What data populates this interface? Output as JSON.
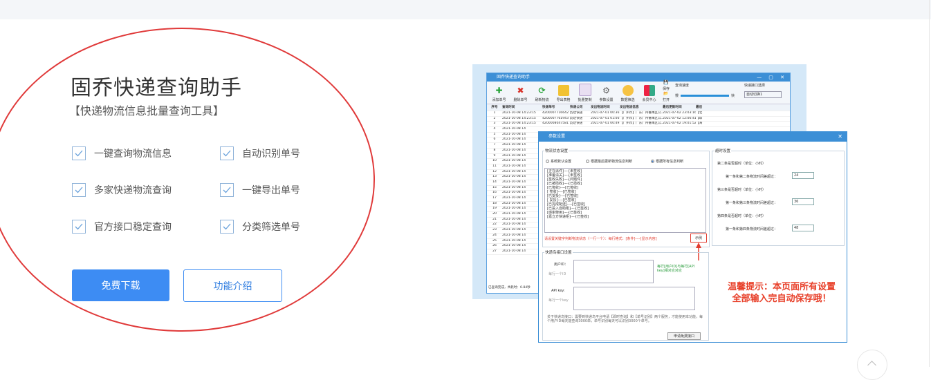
{
  "hero": {
    "title": "固乔快递查询助手",
    "subtitle": "【快递物流信息批量查询工具】",
    "features": [
      "一键查询物流信息",
      "自动识别单号",
      "多家快递物流查询",
      "一键导出单号",
      "官方接口稳定查询",
      "分类筛选单号"
    ],
    "download_label": "免费下载",
    "intro_label": "功能介绍",
    "annotation_color": "#e03a3a",
    "primary_color": "#3d8cf3"
  },
  "screenshot": {
    "main_window": {
      "title": "固乔快递查询助手",
      "toolbar": [
        {
          "label": "添加单号",
          "icon": "plus-icon"
        },
        {
          "label": "删除单号",
          "icon": "delete-x-icon"
        },
        {
          "label": "刷新物流",
          "icon": "refresh-icon"
        },
        {
          "label": "导出表格",
          "icon": "export-icon"
        },
        {
          "label": "批量复制",
          "icon": "copy-icon"
        },
        {
          "label": "参数设置",
          "icon": "gear-icon"
        },
        {
          "label": "数据筛选",
          "icon": "user-filter-icon"
        },
        {
          "label": "会员中心",
          "icon": "vip-icon"
        },
        {
          "label": "保存",
          "icon": "save-icon"
        },
        {
          "label": "打开",
          "icon": "open-icon"
        }
      ],
      "query_speed_label": "查询速度",
      "slow_label": "慢",
      "fast_label": "快",
      "interface_label": "快递接口选择",
      "interface_value": "自动切换1",
      "columns": [
        "序号",
        "查询时间",
        "快递单号",
        "快递公司",
        "发出物流时间",
        "发出物流信息",
        "最后更新时间",
        "最后"
      ],
      "rows": [
        [
          "1",
          "2021-10-08 14:23:15",
          "4200007716642",
          "韵达快递",
          "2021-07-01 00:36:45",
          "【广州市】广东广州番禺区公...",
          "2021-07-02 23:03:16",
          "【北"
        ],
        [
          "2",
          "2021-10-08 14:23:15",
          "4200007761943",
          "韵达快递",
          "2021-07-01 01:00:32",
          "【广州市】广东广州番禺区公...",
          "2021-07-02 12:06:41",
          "【珠"
        ],
        [
          "3",
          "2021-10-08 14:23:15",
          "4200008047581",
          "韵达快递",
          "2021-07-01 00:49:58",
          "【广州市】广东广州番禺区公...",
          "2021-07-02 19:01:52",
          "【海"
        ],
        [
          "4",
          "2021-10-08 14",
          "",
          "",
          "",
          "",
          "",
          ""
        ],
        [
          "5",
          "2021-10-08 14",
          "",
          "",
          "",
          "",
          "",
          ""
        ],
        [
          "6",
          "2021-10-08 14",
          "",
          "",
          "",
          "",
          "",
          ""
        ],
        [
          "7",
          "2021-10-08 14",
          "",
          "",
          "",
          "",
          "",
          ""
        ],
        [
          "8",
          "2021-10-08 14",
          "",
          "",
          "",
          "",
          "",
          ""
        ],
        [
          "9",
          "2021-10-08 14",
          "",
          "",
          "",
          "",
          "",
          ""
        ],
        [
          "10",
          "2021-10-08 14",
          "",
          "",
          "",
          "",
          "",
          ""
        ],
        [
          "11",
          "2021-10-08 14",
          "",
          "",
          "",
          "",
          "",
          ""
        ],
        [
          "12",
          "2021-10-08 14",
          "",
          "",
          "",
          "",
          "",
          ""
        ],
        [
          "13",
          "2021-10-08 14",
          "",
          "",
          "",
          "",
          "",
          ""
        ],
        [
          "14",
          "2021-10-08 14",
          "",
          "",
          "",
          "",
          "",
          ""
        ],
        [
          "15",
          "2021-10-08 14",
          "",
          "",
          "",
          "",
          "",
          ""
        ],
        [
          "16",
          "2021-10-08 14",
          "",
          "",
          "",
          "",
          "",
          ""
        ],
        [
          "17",
          "2021-10-08 14",
          "",
          "",
          "",
          "",
          "",
          ""
        ],
        [
          "18",
          "2021-10-08 14",
          "",
          "",
          "",
          "",
          "",
          ""
        ],
        [
          "19",
          "2021-10-08 14",
          "",
          "",
          "",
          "",
          "",
          ""
        ],
        [
          "20",
          "2021-10-08 14",
          "",
          "",
          "",
          "",
          "",
          ""
        ],
        [
          "21",
          "2021-10-08 14",
          "",
          "",
          "",
          "",
          "",
          ""
        ],
        [
          "22",
          "2021-10-08 14",
          "",
          "",
          "",
          "",
          "",
          ""
        ],
        [
          "23",
          "2021-10-08 14",
          "",
          "",
          "",
          "",
          "",
          ""
        ],
        [
          "24",
          "2021-10-08 14",
          "",
          "",
          "",
          "",
          "",
          ""
        ],
        [
          "25",
          "2021-10-08 14",
          "",
          "",
          "",
          "",
          "",
          ""
        ],
        [
          "26",
          "2021-10-08 14",
          "",
          "",
          "",
          "",
          "",
          ""
        ],
        [
          "27",
          "2021-10-08 14",
          "",
          "",
          "",
          "",
          "",
          ""
        ]
      ],
      "status": "已查询完成，共耗时：0.84秒"
    },
    "settings_dialog": {
      "title": "参数设置",
      "status_group_label": "物流状态设置",
      "radio_options": [
        "系统默认设置",
        "根据最后更新物流信息判断",
        "根据所有信息判断"
      ],
      "status_lines": [
        "[正在派件]----[未签收]",
        "[准备清关]----[未签收]",
        "[签收失败]----[问题件]",
        "[已被揽收]----[已揽收]",
        "[已签收]----[已签收]",
        "[ 签收]----[已签收]",
        "[已妥投]----[已签收]",
        "[ 妥投]----[已签收]",
        "[已完成配送]----[已签收]",
        "[已投入自助柜]----[已签收]",
        "[感谢使用]----[已签收]",
        "[嘉立方快递柜]----[已签收]"
      ],
      "hint_red": "请设置关键字判断物流状态（一行一个）：每行格式：[条件]----[显示内容]",
      "example_label": "示例",
      "timeout_group_label": "超时设置",
      "timeout_unit_note": "（单位：小时）",
      "timeout_items": [
        {
          "heading": "第二条是否超时",
          "label": "第一条和第二条物流时间差超过：",
          "value": "24"
        },
        {
          "heading": "第三条是否超时",
          "label": "第一条和第三条物流时间差超过：",
          "value": "36"
        },
        {
          "heading": "第四条是否超时",
          "label": "第一条和第四条物流时间差超过：",
          "value": "48"
        }
      ],
      "api_group_label": "快递鸟接口设置",
      "user_id_label": "用户ID：",
      "user_id_placeholder": "每行一个ID",
      "api_key_label": "API key:",
      "api_key_placeholder": "每行一个key",
      "green_note": "每行[用户ID]与每行[API key]相对应对应",
      "api_note": "关于快递鸟接口：需要到快递鸟平台申请【即时查询】和【单号识别】两个服务，才能使用本功能，每个用户ID每天能查询3000单，单号识别每天可以识别3000个单号。",
      "apply_button": "申请免费接口"
    },
    "warning_line1": "温馨提示：本页面所有设置",
    "warning_line2": "全部输入完自动保存哦！"
  }
}
